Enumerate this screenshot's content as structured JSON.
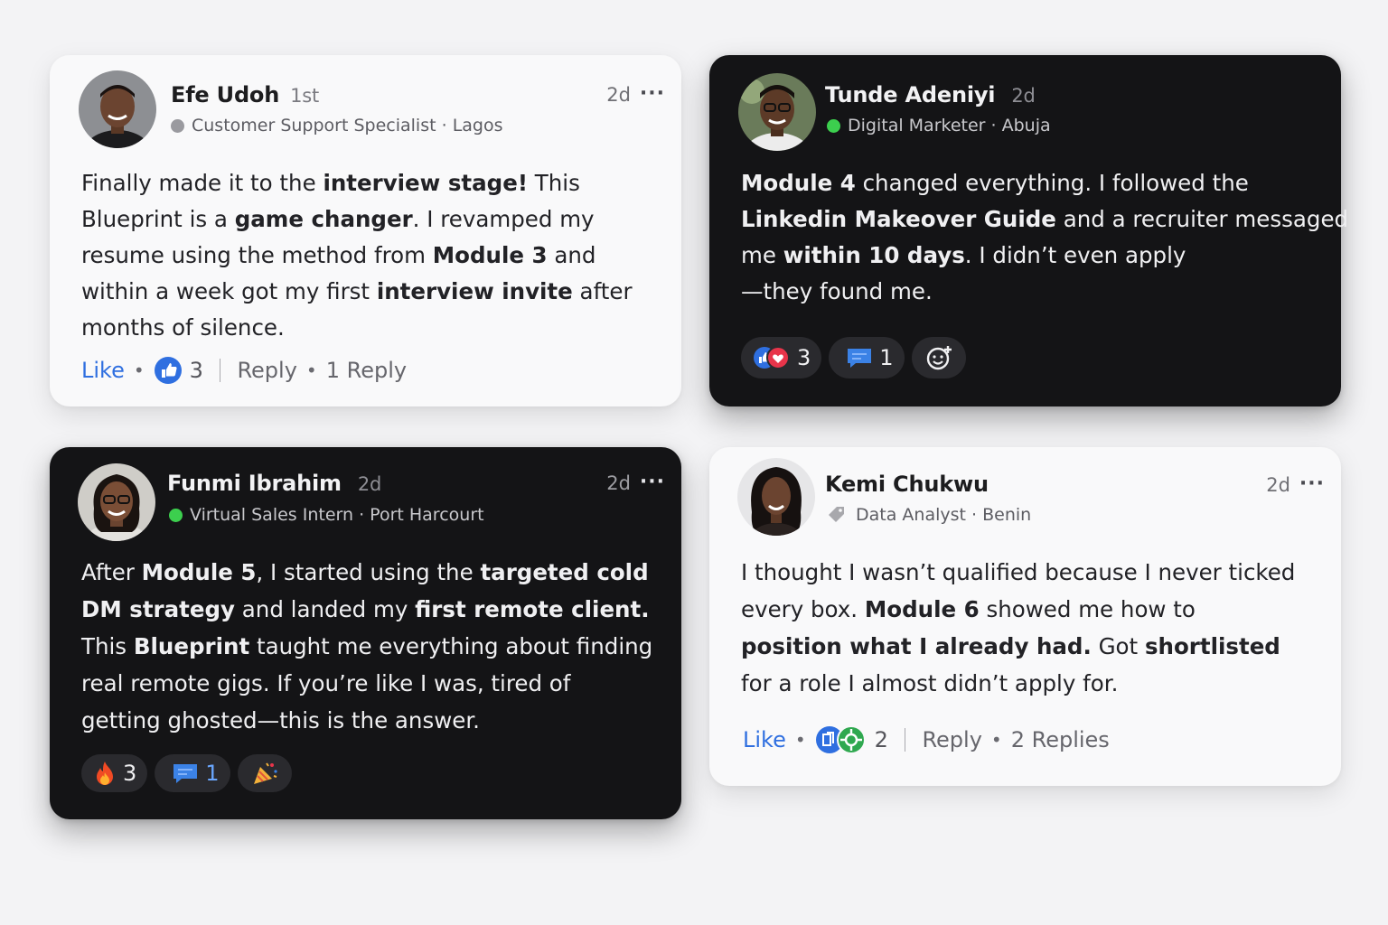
{
  "posts": [
    {
      "theme": "light",
      "name": "Efe Udoh",
      "degree": "1st",
      "title": "Customer Support Specialist",
      "location": "Lagos",
      "status_color": "#9a9a9f",
      "time": "2d",
      "more": "···",
      "body_lines": [
        [
          "Finally made it to the ",
          "interview stage!",
          " This"
        ],
        [
          "Blueprint is a ",
          "game changer",
          ". I revamped my"
        ],
        [
          "resume using the method from ",
          "Module 3",
          " and"
        ],
        [
          "within a week got my first ",
          "interview invite",
          " after"
        ],
        [
          "months of silence.",
          "",
          ""
        ]
      ],
      "actions": {
        "like": "Like",
        "reaction_count": "3",
        "reply": "Reply",
        "replies": "1 Reply"
      }
    },
    {
      "theme": "dark",
      "name": "Tunde Adeniyi",
      "degree": "2d",
      "title": "Digital Marketer",
      "location": "Abuja",
      "status_color": "#3ccf4e",
      "body_lines": [
        [
          "",
          "Module 4",
          " changed everything. I followed the"
        ],
        [
          "",
          "Linkedin Makeover Guide",
          " and a recruiter messaged"
        ],
        [
          "me ",
          "within 10 days",
          ". I didn’t even apply"
        ],
        [
          "—they found me.",
          "",
          ""
        ]
      ],
      "pills": [
        {
          "icon": "like-love-icon",
          "count": "3"
        },
        {
          "icon": "comment-icon",
          "count": "1"
        },
        {
          "icon": "add-reaction-icon",
          "count": ""
        }
      ]
    },
    {
      "theme": "dark",
      "name": "Funmi Ibrahim",
      "degree": "2d",
      "title": "Virtual Sales Intern",
      "location": "Port Harcourt",
      "status_color": "#3ccf4e",
      "time": "2d",
      "more": "···",
      "body_lines": [
        [
          "After ",
          "Module 5",
          ", I started using the ",
          "targeted cold"
        ],
        [
          "",
          "DM strategy",
          " and landed my ",
          "first remote client."
        ],
        [
          "This ",
          "Blueprint",
          " taught me everything about finding"
        ],
        [
          "real remote gigs. If you’re like I was, tired of",
          "",
          ""
        ],
        [
          "getting ghosted—this is the answer.",
          "",
          ""
        ]
      ],
      "pills": [
        {
          "icon": "fire-icon",
          "count": "3"
        },
        {
          "icon": "comment-icon",
          "count": "1"
        },
        {
          "icon": "celebrate-icon",
          "count": ""
        }
      ]
    },
    {
      "theme": "light",
      "name": "Kemi Chukwu",
      "title": "Data Analyst",
      "location": "Benin",
      "time": "2d",
      "more": "···",
      "body_lines": [
        [
          "I thought I wasn’t qualified because I never ticked",
          "",
          ""
        ],
        [
          "every box. ",
          "Module 6",
          " showed me how to"
        ],
        [
          "",
          "position what I already had.",
          " Got ",
          "shortlisted"
        ],
        [
          "for a role I almost didn’t apply for.",
          "",
          ""
        ]
      ],
      "actions": {
        "like": "Like",
        "reaction_count": "2",
        "reply": "Reply",
        "replies": "2 Replies"
      }
    }
  ],
  "colors": {
    "like_blue": "#2f6fe0",
    "online_green": "#3ccf4e",
    "love_red": "#e8344a"
  }
}
